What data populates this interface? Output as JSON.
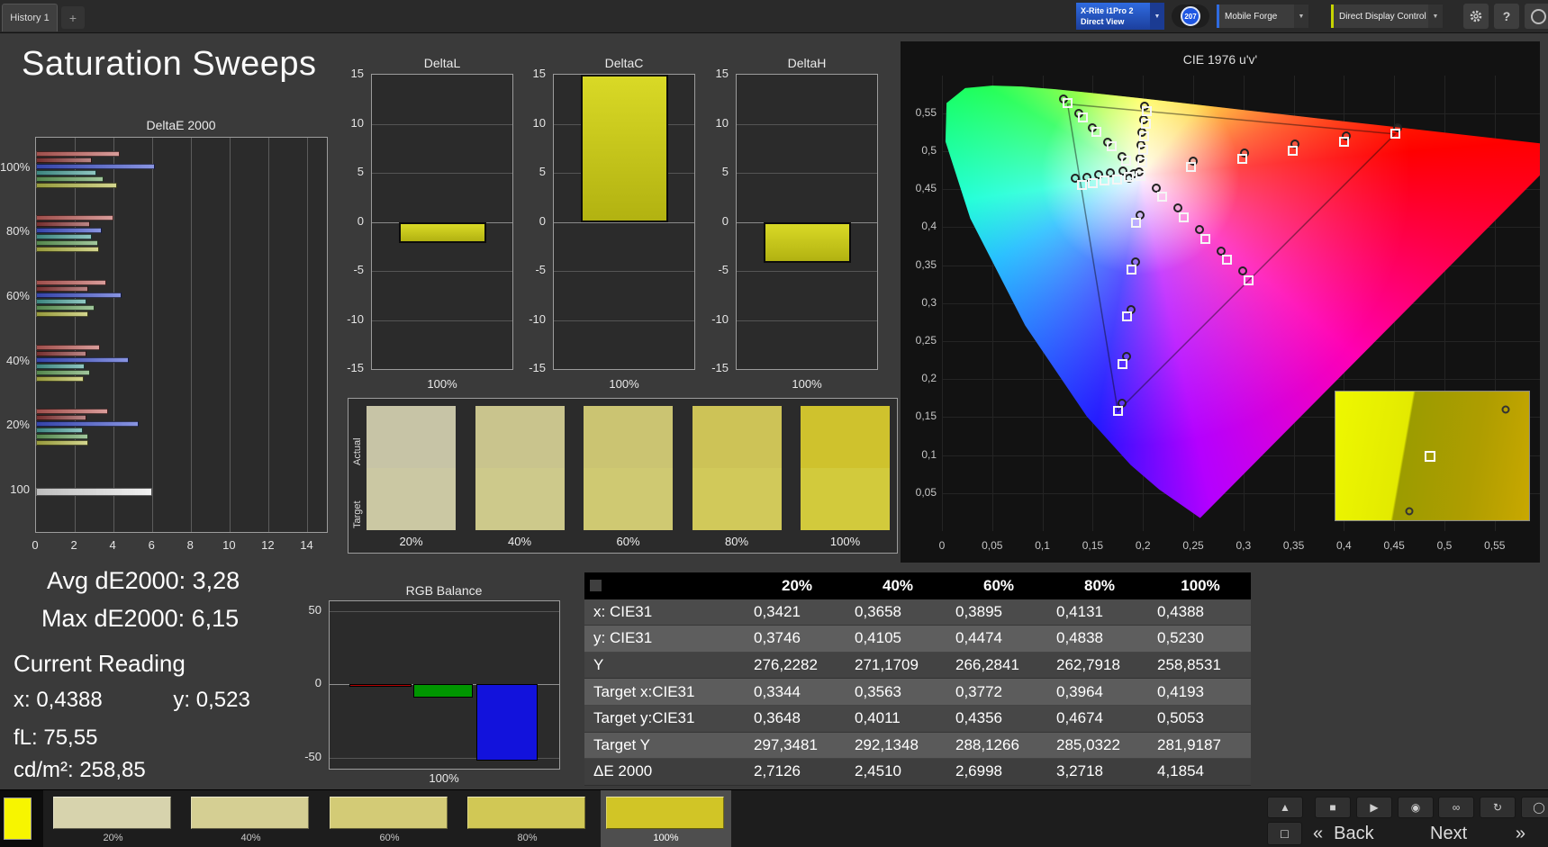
{
  "top_bar": {
    "history_tab": "History 1",
    "new_tab_label": "+",
    "meter_selector": {
      "line1": "X-Rite i1Pro 2",
      "line2": "Direct View"
    },
    "badge_count": "207",
    "source_selector": "Mobile Forge",
    "display_control_selector": "Direct Display Control",
    "help_label": "?"
  },
  "icons": {
    "chevron_down": "▼"
  },
  "page_title": "Saturation Sweeps",
  "summary": {
    "avg": "Avg dE2000: 3,28",
    "max": "Max dE2000: 6,15",
    "current_reading": "Current Reading",
    "x": "x: 0,4388",
    "y": "y: 0,523",
    "fl": "fL: 75,55",
    "cd": "cd/m²: 258,85"
  },
  "swatch_compare": {
    "row_labels": [
      "Actual",
      "Target"
    ],
    "labels": [
      "20%",
      "40%",
      "60%",
      "80%",
      "100%"
    ],
    "actual_colors": [
      "#c7c4a6",
      "#c9c48d",
      "#cbc472",
      "#cdc357",
      "#cfc22d"
    ],
    "target_colors": [
      "#cbc8a3",
      "#cdc98b",
      "#cfc972",
      "#d1c95a",
      "#d2ca3c"
    ]
  },
  "bottom_swatches": {
    "current_patch_color": "#f7f500",
    "selected_index": 4,
    "items": [
      {
        "label": "20%",
        "color": "#d7d3ad"
      },
      {
        "label": "40%",
        "color": "#d5cf93"
      },
      {
        "label": "60%",
        "color": "#d3cb76"
      },
      {
        "label": "80%",
        "color": "#d1c855"
      },
      {
        "label": "100%",
        "color": "#d1c526"
      }
    ]
  },
  "transport": {
    "buttons": [
      {
        "name": "eject-icon",
        "glyph": "▲"
      },
      {
        "name": "stop-icon",
        "glyph": "■"
      },
      {
        "name": "play-icon",
        "glyph": "▶"
      },
      {
        "name": "record-icon",
        "glyph": "◉"
      },
      {
        "name": "loop-icon",
        "glyph": "∞"
      },
      {
        "name": "refresh-icon",
        "glyph": "↻"
      },
      {
        "name": "partial-icon",
        "glyph": "◯"
      }
    ],
    "stop_button_glyph": "□",
    "back_chevron": "«",
    "back_label": "Back",
    "next_label": "Next",
    "next_chevron": "»"
  },
  "chart_data": [
    {
      "id": "deltae2000",
      "type": "bar",
      "orientation": "horizontal",
      "title": "DeltaE 2000",
      "xlim": [
        0,
        15
      ],
      "xticks": [
        0,
        2,
        4,
        6,
        8,
        10,
        12,
        14
      ],
      "bar_colors": [
        "#c2605c",
        "#8f3a3a",
        "#4053cf",
        "#4aa39b",
        "#67a45e",
        "#b8bc49"
      ],
      "white_color": "#e8e8e8",
      "groups": [
        {
          "label": "100%",
          "values": [
            4.3,
            2.9,
            6.15,
            3.1,
            3.5,
            4.19
          ]
        },
        {
          "label": "80%",
          "values": [
            4.0,
            2.8,
            3.4,
            2.9,
            3.2,
            3.27
          ]
        },
        {
          "label": "60%",
          "values": [
            3.6,
            2.7,
            4.4,
            2.6,
            3.0,
            2.7
          ]
        },
        {
          "label": "40%",
          "values": [
            3.3,
            2.6,
            4.8,
            2.5,
            2.8,
            2.45
          ]
        },
        {
          "label": "20%",
          "values": [
            3.7,
            2.6,
            5.3,
            2.4,
            2.7,
            2.71
          ]
        },
        {
          "label": "100",
          "values": [
            6.0
          ]
        }
      ]
    },
    {
      "id": "deltaL",
      "type": "bar",
      "title": "DeltaL",
      "ylim": [
        -15,
        15
      ],
      "yticks": [
        15,
        10,
        5,
        0,
        -5,
        -10,
        -15
      ],
      "categories": [
        "100%"
      ],
      "values": [
        -2.2
      ],
      "xlabel": "100%"
    },
    {
      "id": "deltaC",
      "type": "bar",
      "title": "DeltaC",
      "ylim": [
        -15,
        15
      ],
      "yticks": [
        15,
        10,
        5,
        0,
        -5,
        -10,
        -15
      ],
      "categories": [
        "100%"
      ],
      "values": [
        15.6
      ],
      "clipped": true,
      "xlabel": "100%"
    },
    {
      "id": "deltaH",
      "type": "bar",
      "title": "DeltaH",
      "ylim": [
        -15,
        15
      ],
      "yticks": [
        15,
        10,
        5,
        0,
        -5,
        -10,
        -15
      ],
      "categories": [
        "100%"
      ],
      "values": [
        -4.2
      ],
      "xlabel": "100%"
    },
    {
      "id": "rgb_balance",
      "type": "bar",
      "title": "RGB Balance",
      "ylim": [
        -55,
        55
      ],
      "yticks": [
        50,
        0,
        -50
      ],
      "categories": [
        "100%"
      ],
      "xlabel": "100%",
      "series": [
        {
          "name": "red",
          "value": -2,
          "color": "#b40000"
        },
        {
          "name": "green",
          "value": -9,
          "color": "#009600"
        },
        {
          "name": "blue",
          "value": -52,
          "color": "#1212dc"
        }
      ]
    },
    {
      "id": "cie1976",
      "type": "scatter",
      "title": "CIE 1976 u'v'",
      "xtick_values": [
        0,
        0.05,
        0.1,
        0.15,
        0.2,
        0.25,
        0.3,
        0.35,
        0.4,
        0.45,
        0.5,
        0.55
      ],
      "xtick_labels": [
        "0",
        "0,05",
        "0,1",
        "0,15",
        "0,2",
        "0,25",
        "0,3",
        "0,35",
        "0,4",
        "0,45",
        "0,5",
        "0,55"
      ],
      "ytick_values": [
        0.05,
        0.1,
        0.15,
        0.2,
        0.25,
        0.3,
        0.35,
        0.4,
        0.45,
        0.5,
        0.55
      ],
      "ytick_labels": [
        "0,05",
        "0,1",
        "0,15",
        "0,2",
        "0,25",
        "0,3",
        "0,35",
        "0,4",
        "0,45",
        "0,5",
        "0,55"
      ],
      "white_point": [
        0.198,
        0.468
      ],
      "srgb_triangle": [
        [
          0.451,
          0.523
        ],
        [
          0.125,
          0.5625
        ],
        [
          0.175,
          0.158
        ]
      ],
      "locus": [
        [
          0.2569,
          0.0172
        ],
        [
          0.2161,
          0.0549
        ],
        [
          0.1877,
          0.0871
        ],
        [
          0.1441,
          0.151
        ],
        [
          0.0828,
          0.2708
        ],
        [
          0.0282,
          0.4117
        ],
        [
          0.0035,
          0.5131
        ],
        [
          0.0046,
          0.5639
        ],
        [
          0.0231,
          0.5836
        ],
        [
          0.0501,
          0.5868
        ],
        [
          0.0792,
          0.5856
        ],
        [
          0.1127,
          0.5821
        ],
        [
          0.1531,
          0.5766
        ],
        [
          0.2026,
          0.5694
        ],
        [
          0.2623,
          0.5604
        ],
        [
          0.3315,
          0.5501
        ],
        [
          0.4035,
          0.5393
        ],
        [
          0.4692,
          0.5296
        ],
        [
          0.5203,
          0.5219
        ],
        [
          0.583,
          0.5125
        ],
        [
          0.6234,
          0.5065
        ]
      ],
      "targets": [
        [
          0.248,
          0.479
        ],
        [
          0.299,
          0.49
        ],
        [
          0.349,
          0.501
        ],
        [
          0.4,
          0.512
        ],
        [
          0.451,
          0.523
        ],
        [
          0.183,
          0.487
        ],
        [
          0.169,
          0.506
        ],
        [
          0.154,
          0.525
        ],
        [
          0.14,
          0.544
        ],
        [
          0.125,
          0.563
        ],
        [
          0.193,
          0.406
        ],
        [
          0.189,
          0.344
        ],
        [
          0.184,
          0.282
        ],
        [
          0.18,
          0.22
        ],
        [
          0.175,
          0.158
        ],
        [
          0.199,
          0.485
        ],
        [
          0.2,
          0.502
        ],
        [
          0.201,
          0.519
        ],
        [
          0.203,
          0.536
        ],
        [
          0.204,
          0.553
        ],
        [
          0.186,
          0.466
        ],
        [
          0.174,
          0.463
        ],
        [
          0.162,
          0.461
        ],
        [
          0.15,
          0.458
        ],
        [
          0.139,
          0.456
        ],
        [
          0.219,
          0.44
        ],
        [
          0.241,
          0.413
        ],
        [
          0.262,
          0.385
        ],
        [
          0.284,
          0.357
        ],
        [
          0.305,
          0.33
        ],
        [
          0.198,
          0.468
        ]
      ],
      "measured": [
        [
          0.25,
          0.487
        ],
        [
          0.301,
          0.498
        ],
        [
          0.351,
          0.509
        ],
        [
          0.402,
          0.52
        ],
        [
          0.453,
          0.531
        ],
        [
          0.179,
          0.493
        ],
        [
          0.165,
          0.512
        ],
        [
          0.15,
          0.531
        ],
        [
          0.136,
          0.55
        ],
        [
          0.121,
          0.569
        ],
        [
          0.197,
          0.416
        ],
        [
          0.193,
          0.354
        ],
        [
          0.188,
          0.292
        ],
        [
          0.184,
          0.23
        ],
        [
          0.179,
          0.168
        ],
        [
          0.197,
          0.491
        ],
        [
          0.198,
          0.508
        ],
        [
          0.199,
          0.525
        ],
        [
          0.201,
          0.542
        ],
        [
          0.202,
          0.559
        ],
        [
          0.18,
          0.474
        ],
        [
          0.168,
          0.471
        ],
        [
          0.156,
          0.469
        ],
        [
          0.144,
          0.466
        ],
        [
          0.133,
          0.464
        ],
        [
          0.213,
          0.452
        ],
        [
          0.235,
          0.425
        ],
        [
          0.256,
          0.397
        ],
        [
          0.278,
          0.369
        ],
        [
          0.299,
          0.342
        ],
        [
          0.191,
          0.47
        ],
        [
          0.186,
          0.464
        ],
        [
          0.196,
          0.473
        ]
      ],
      "inset": {
        "square": [
          49,
          50
        ],
        "circles": [
          [
            88,
            14
          ],
          [
            38,
            93
          ]
        ]
      }
    },
    {
      "id": "saturation_table",
      "type": "table",
      "columns": [
        "20%",
        "40%",
        "60%",
        "80%",
        "100%"
      ],
      "rows": [
        {
          "label": "x: CIE31",
          "values": [
            "0,3421",
            "0,3658",
            "0,3895",
            "0,4131",
            "0,4388"
          ]
        },
        {
          "label": "y: CIE31",
          "values": [
            "0,3746",
            "0,4105",
            "0,4474",
            "0,4838",
            "0,5230"
          ]
        },
        {
          "label": "Y",
          "values": [
            "276,2282",
            "271,1709",
            "266,2841",
            "262,7918",
            "258,8531"
          ]
        },
        {
          "label": "Target x:CIE31",
          "values": [
            "0,3344",
            "0,3563",
            "0,3772",
            "0,3964",
            "0,4193"
          ]
        },
        {
          "label": "Target y:CIE31",
          "values": [
            "0,3648",
            "0,4011",
            "0,4356",
            "0,4674",
            "0,5053"
          ]
        },
        {
          "label": "Target Y",
          "values": [
            "297,3481",
            "292,1348",
            "288,1266",
            "285,0322",
            "281,9187"
          ]
        },
        {
          "label": "ΔE 2000",
          "values": [
            "2,7126",
            "2,4510",
            "2,6998",
            "3,2718",
            "4,1854"
          ]
        }
      ]
    }
  ]
}
